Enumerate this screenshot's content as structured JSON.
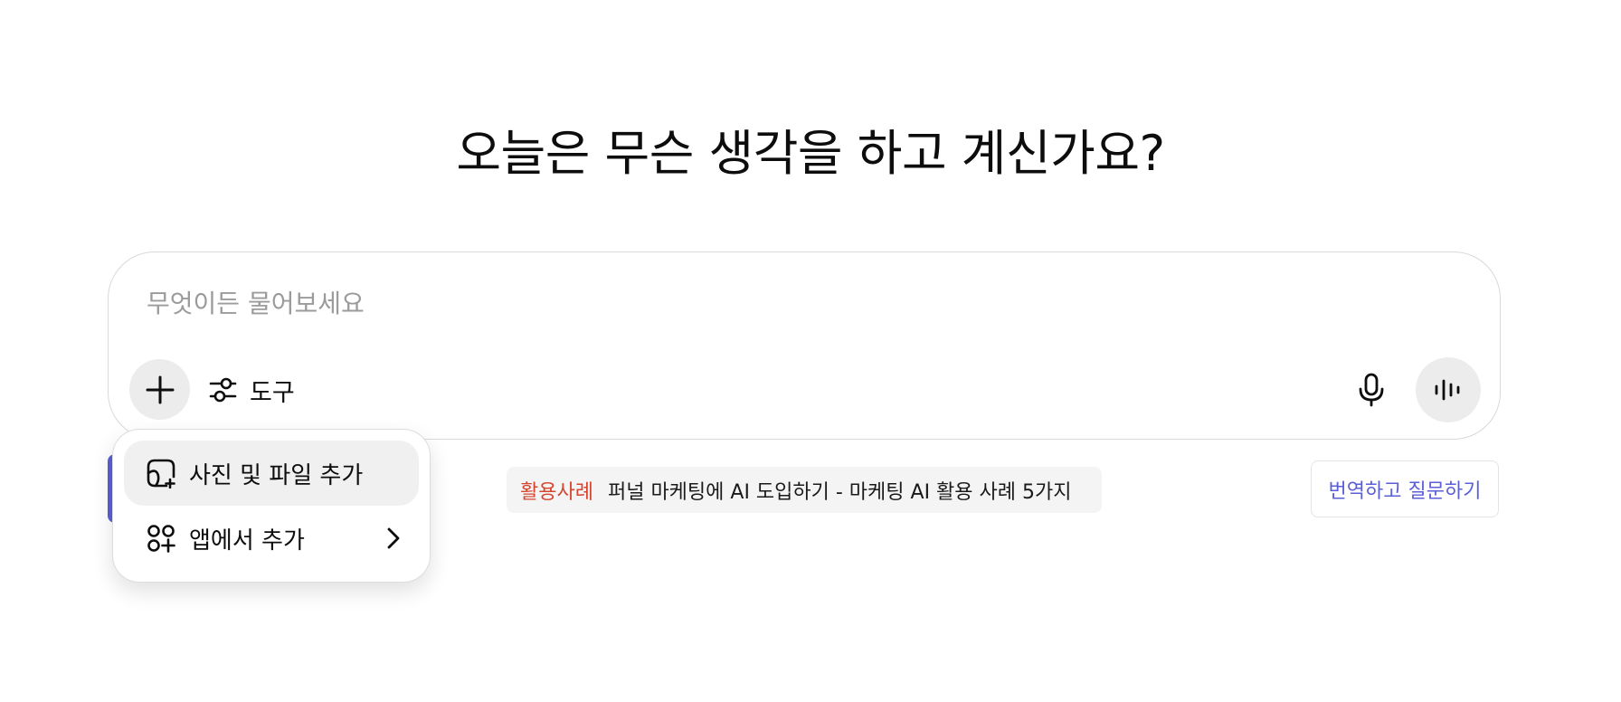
{
  "headline": "오늘은 무슨 생각을 하고 계신가요?",
  "composer": {
    "placeholder": "무엇이든 물어보세요",
    "value": "",
    "tools_label": "도구",
    "icons": {
      "plus": "plus-icon",
      "tools": "sliders-icon",
      "mic": "microphone-icon",
      "voice": "voice-waveform-icon"
    }
  },
  "attach_menu": {
    "items": [
      {
        "label": "사진 및 파일 추가",
        "icon": "add-file-icon"
      },
      {
        "label": "앱에서 추가",
        "icon": "add-apps-icon",
        "submenu_icon": "chevron-right-icon"
      }
    ]
  },
  "usecase": {
    "tag": "활용사례",
    "text": "퍼널 마케팅에 AI 도입하기 - 마케팅 AI 활용 사례 5가지"
  },
  "translate_button": "번역하고 질문하기",
  "colors": {
    "accent": "#5b5fd6",
    "usecase_tag": "#d6452f",
    "pill_background": "#ececec"
  }
}
